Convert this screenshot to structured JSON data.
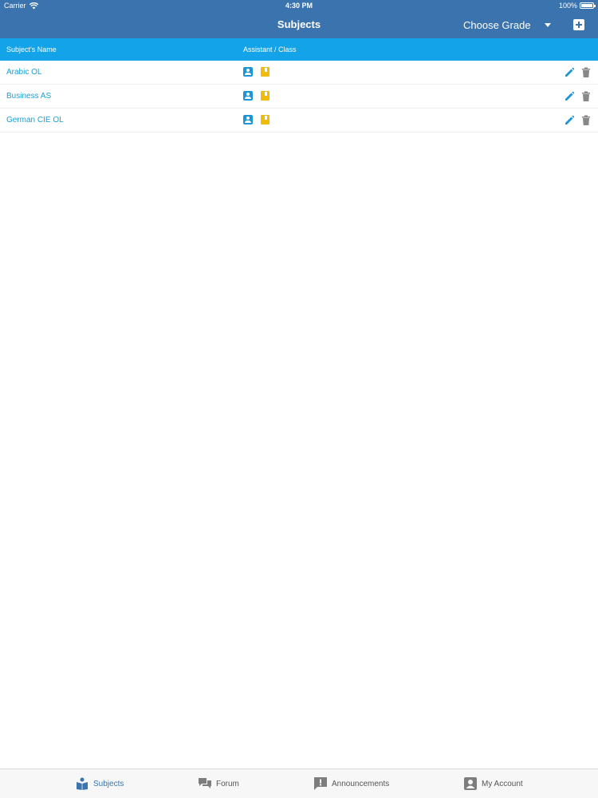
{
  "status_bar": {
    "carrier": "Carrier",
    "time": "4:30 PM",
    "battery": "100%"
  },
  "nav": {
    "title": "Subjects",
    "grade_select": "Choose Grade"
  },
  "table": {
    "headers": {
      "name": "Subject's Name",
      "assistant_class": "Assistant / Class"
    },
    "rows": [
      {
        "name": "Arabic OL"
      },
      {
        "name": "Business AS"
      },
      {
        "name": "German CIE OL"
      }
    ]
  },
  "tabs": [
    {
      "label": "Subjects",
      "icon": "book-reader-icon"
    },
    {
      "label": "Forum",
      "icon": "chat-bubbles-icon"
    },
    {
      "label": "Announcements",
      "icon": "announcement-icon"
    },
    {
      "label": "My Account",
      "icon": "account-icon"
    }
  ],
  "colors": {
    "header": "#3a73ad",
    "table_header": "#12a3e8",
    "link": "#1c9fd8",
    "assistant_icon": "#1e96d6",
    "class_icon": "#f1bb0e",
    "delete_icon": "#888888",
    "tab_icon": "#7d7d7d"
  }
}
